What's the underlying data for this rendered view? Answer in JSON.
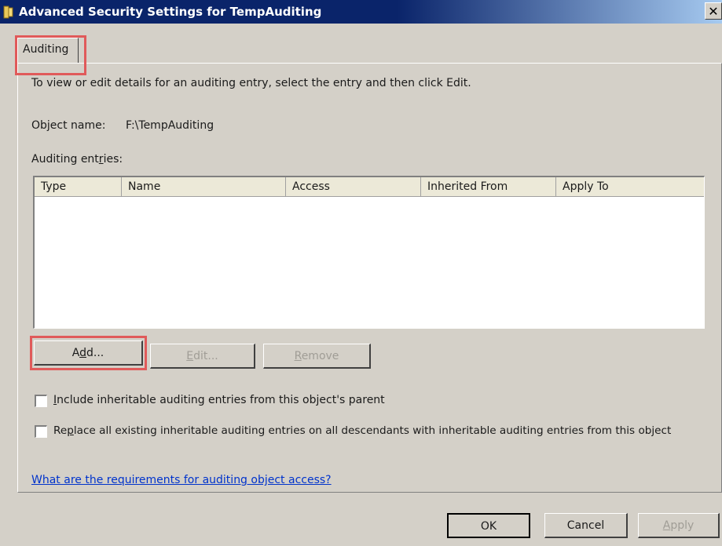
{
  "window": {
    "title": "Advanced Security Settings for TempAuditing",
    "icon": "folder-icon",
    "close_glyph": "✕"
  },
  "tabs": [
    {
      "label": "Auditing",
      "selected": true
    }
  ],
  "panel": {
    "instruction": "To view or edit details for an auditing entry, select the entry and then click Edit.",
    "object_name_label": "Object name:",
    "object_name_value": "F:\\TempAuditing",
    "entries_label_pre": "Auditing ent",
    "entries_label_u": "r",
    "entries_label_post": "ies:",
    "columns": [
      "Type",
      "Name",
      "Access",
      "Inherited From",
      "Apply To"
    ],
    "rows": []
  },
  "entry_buttons": {
    "add_pre": "A",
    "add_u": "d",
    "add_post": "d...",
    "edit_u": "E",
    "edit_post": "dit...",
    "remove_u": "R",
    "remove_post": "emove"
  },
  "options": {
    "include_u": "I",
    "include_post": "nclude inheritable auditing entries from this object's parent",
    "include_checked": false,
    "replace_pre": "Re",
    "replace_u": "p",
    "replace_post": "lace all existing inheritable auditing entries on all descendants with inheritable auditing entries from this object",
    "replace_checked": false
  },
  "help_link": "What are the requirements for auditing object access?",
  "footer": {
    "ok": "OK",
    "cancel": "Cancel",
    "apply_u": "A",
    "apply_post": "pply"
  },
  "colors": {
    "highlight": "#e05a5a",
    "titlebar": "#0a246a",
    "link": "#0033cc"
  }
}
